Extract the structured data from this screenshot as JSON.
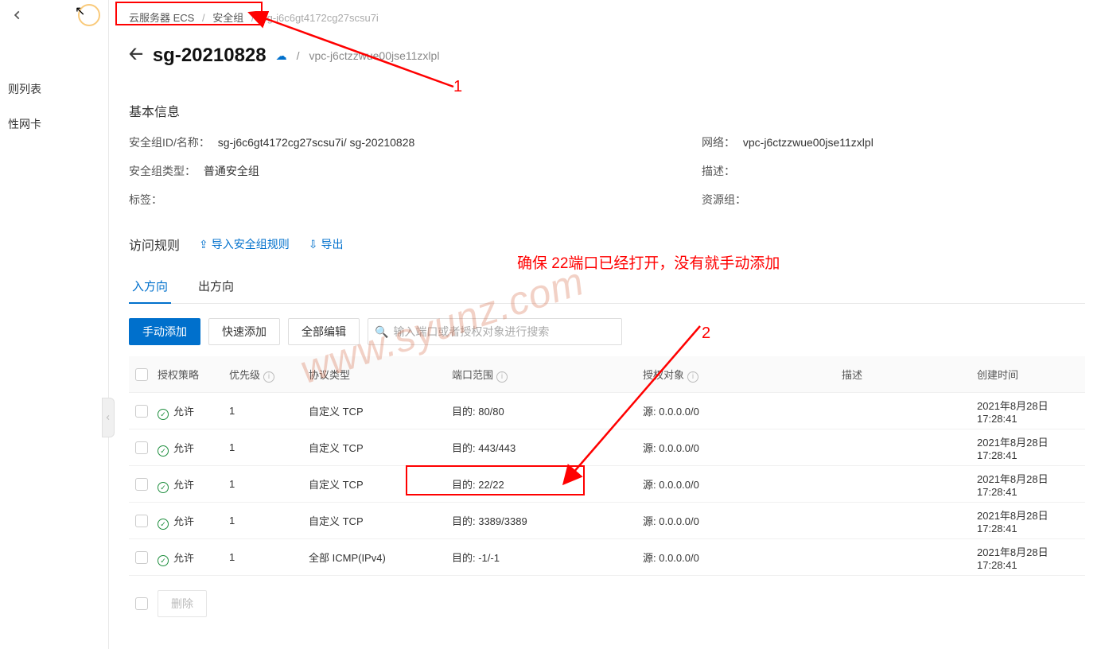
{
  "sidebar": {
    "items": [
      "则列表",
      "性网卡"
    ]
  },
  "breadcrumb": {
    "a": "云服务器 ECS",
    "b": "安全组",
    "c": "sg-j6c6gt4172cg27scsu7i"
  },
  "header": {
    "title": "sg-20210828",
    "vpc_prefix": "/",
    "vpc": "vpc-j6ctzzwue00jse11zxlpl"
  },
  "basic": {
    "section_title": "基本信息",
    "id_label": "安全组ID/名称：",
    "id_value": "sg-j6c6gt4172cg27scsu7i/ sg-20210828",
    "net_label": "网络：",
    "net_value": "vpc-j6ctzzwue00jse11zxlpl",
    "type_label": "安全组类型：",
    "type_value": "普通安全组",
    "desc_label": "描述：",
    "desc_value": "",
    "tag_label": "标签：",
    "tag_value": "",
    "res_label": "资源组：",
    "res_value": ""
  },
  "rules": {
    "title": "访问规则",
    "import": "导入安全组规则",
    "export": "导出",
    "tab_in": "入方向",
    "tab_out": "出方向"
  },
  "toolbar": {
    "add_manual": "手动添加",
    "add_quick": "快速添加",
    "edit_all": "全部编辑",
    "search_placeholder": "输入端口或者授权对象进行搜索"
  },
  "columns": {
    "policy": "授权策略",
    "priority": "优先级",
    "protocol": "协议类型",
    "port": "端口范围",
    "auth": "授权对象",
    "desc": "描述",
    "time": "创建时间"
  },
  "rows": [
    {
      "policy": "允许",
      "priority": "1",
      "protocol": "自定义 TCP",
      "port": "目的: 80/80",
      "auth": "源: 0.0.0.0/0",
      "desc": "",
      "time": "2021年8月28日 17:28:41"
    },
    {
      "policy": "允许",
      "priority": "1",
      "protocol": "自定义 TCP",
      "port": "目的: 443/443",
      "auth": "源: 0.0.0.0/0",
      "desc": "",
      "time": "2021年8月28日 17:28:41"
    },
    {
      "policy": "允许",
      "priority": "1",
      "protocol": "自定义 TCP",
      "port": "目的: 22/22",
      "auth": "源: 0.0.0.0/0",
      "desc": "",
      "time": "2021年8月28日 17:28:41"
    },
    {
      "policy": "允许",
      "priority": "1",
      "protocol": "自定义 TCP",
      "port": "目的: 3389/3389",
      "auth": "源: 0.0.0.0/0",
      "desc": "",
      "time": "2021年8月28日 17:28:41"
    },
    {
      "policy": "允许",
      "priority": "1",
      "protocol": "全部 ICMP(IPv4)",
      "port": "目的: -1/-1",
      "auth": "源: 0.0.0.0/0",
      "desc": "",
      "time": "2021年8月28日 17:28:41"
    }
  ],
  "footer": {
    "delete": "删除"
  },
  "annotations": {
    "label1": "1",
    "label2": "2",
    "text2": "确保 22端口已经打开，没有就手动添加",
    "watermark": "www.syunz.com"
  }
}
